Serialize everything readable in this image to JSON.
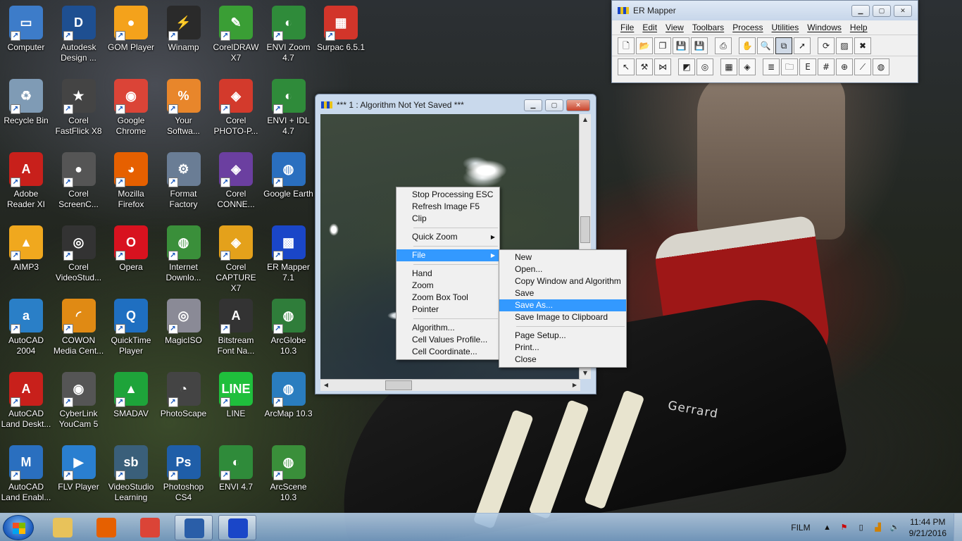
{
  "desktop_icons": [
    {
      "label": "Computer",
      "icon": "computer-icon",
      "color": "#3d7cc9",
      "glyph": "▭",
      "col": 0,
      "row": 0
    },
    {
      "label": "Autodesk Design ...",
      "icon": "autodesk-design-icon",
      "color": "#1e4f91",
      "glyph": "D",
      "col": 1,
      "row": 0
    },
    {
      "label": "GOM Player",
      "icon": "gom-player-icon",
      "color": "#f4a21b",
      "glyph": "●",
      "col": 2,
      "row": 0
    },
    {
      "label": "Winamp",
      "icon": "winamp-icon",
      "color": "#2a2a2a",
      "glyph": "⚡",
      "col": 3,
      "row": 0
    },
    {
      "label": "CorelDRAW X7",
      "icon": "coreldraw-icon",
      "color": "#3a9e35",
      "glyph": "✎",
      "col": 4,
      "row": 0
    },
    {
      "label": "ENVI Zoom 4.7",
      "icon": "envi-zoom-icon",
      "color": "#2f8b3a",
      "glyph": "◐",
      "col": 5,
      "row": 0
    },
    {
      "label": "Surpac 6.5.1",
      "icon": "surpac-icon",
      "color": "#d2352a",
      "glyph": "▦",
      "col": 6,
      "row": 0
    },
    {
      "label": "Recycle Bin",
      "icon": "recycle-bin-icon",
      "color": "#7f9bb5",
      "glyph": "♻",
      "col": 0,
      "row": 1
    },
    {
      "label": "Corel FastFlick X8",
      "icon": "fastflick-icon",
      "color": "#444444",
      "glyph": "★",
      "col": 1,
      "row": 1
    },
    {
      "label": "Google Chrome",
      "icon": "chrome-icon",
      "color": "#db4437",
      "glyph": "◉",
      "col": 2,
      "row": 1
    },
    {
      "label": "Your Softwa...",
      "icon": "your-software-icon",
      "color": "#e8862b",
      "glyph": "%",
      "col": 3,
      "row": 1
    },
    {
      "label": "Corel PHOTO-P...",
      "icon": "corel-photopaint-icon",
      "color": "#d33a2c",
      "glyph": "◈",
      "col": 4,
      "row": 1
    },
    {
      "label": "ENVI + IDL 4.7",
      "icon": "envi-idl-icon",
      "color": "#2f8b3a",
      "glyph": "◐",
      "col": 5,
      "row": 1
    },
    {
      "label": "Adobe Reader XI",
      "icon": "adobe-reader-icon",
      "color": "#c8201b",
      "glyph": "A",
      "col": 0,
      "row": 2
    },
    {
      "label": "Corel ScreenC...",
      "icon": "corel-screencap-icon",
      "color": "#555555",
      "glyph": "●",
      "col": 1,
      "row": 2
    },
    {
      "label": "Mozilla Firefox",
      "icon": "firefox-icon",
      "color": "#e66000",
      "glyph": "◕",
      "col": 2,
      "row": 2
    },
    {
      "label": "Format Factory",
      "icon": "format-factory-icon",
      "color": "#6a7d95",
      "glyph": "⚙",
      "col": 3,
      "row": 2
    },
    {
      "label": "Corel CONNE...",
      "icon": "corel-connect-icon",
      "color": "#6b3fa0",
      "glyph": "◈",
      "col": 4,
      "row": 2
    },
    {
      "label": "Google Earth",
      "icon": "google-earth-icon",
      "color": "#2a6fbf",
      "glyph": "◍",
      "col": 5,
      "row": 2
    },
    {
      "label": "AIMP3",
      "icon": "aimp-icon",
      "color": "#f0a81e",
      "glyph": "▲",
      "col": 0,
      "row": 3
    },
    {
      "label": "Corel VideoStud...",
      "icon": "corel-videostudio-icon",
      "color": "#333333",
      "glyph": "◎",
      "col": 1,
      "row": 3
    },
    {
      "label": "Opera",
      "icon": "opera-icon",
      "color": "#d8121f",
      "glyph": "O",
      "col": 2,
      "row": 3
    },
    {
      "label": "Internet Downlo...",
      "icon": "internet-download-icon",
      "color": "#3a8f3a",
      "glyph": "◍",
      "col": 3,
      "row": 3
    },
    {
      "label": "Corel CAPTURE X7",
      "icon": "corel-capture-icon",
      "color": "#e4a11b",
      "glyph": "◈",
      "col": 4,
      "row": 3
    },
    {
      "label": "ER Mapper 7.1",
      "icon": "er-mapper-icon",
      "color": "#1a46c8",
      "glyph": "▩",
      "col": 5,
      "row": 3
    },
    {
      "label": "AutoCAD 2004",
      "icon": "autocad-2004-icon",
      "color": "#2a7fc7",
      "glyph": "a",
      "col": 0,
      "row": 4
    },
    {
      "label": "COWON Media Cent...",
      "icon": "cowon-icon",
      "color": "#e08a14",
      "glyph": "◜",
      "col": 1,
      "row": 4
    },
    {
      "label": "QuickTime Player",
      "icon": "quicktime-icon",
      "color": "#1f6fc1",
      "glyph": "Q",
      "col": 2,
      "row": 4
    },
    {
      "label": "MagicISO",
      "icon": "magiciso-icon",
      "color": "#8a8a96",
      "glyph": "◎",
      "col": 3,
      "row": 4
    },
    {
      "label": "Bitstream Font Na...",
      "icon": "bitstream-icon",
      "color": "#333333",
      "glyph": "A",
      "col": 4,
      "row": 4
    },
    {
      "label": "ArcGlobe 10.3",
      "icon": "arcglobe-icon",
      "color": "#2f7d3a",
      "glyph": "◍",
      "col": 5,
      "row": 4
    },
    {
      "label": "AutoCAD Land Deskt...",
      "icon": "autocad-land-desktop-icon",
      "color": "#c8201b",
      "glyph": "A",
      "col": 0,
      "row": 5
    },
    {
      "label": "CyberLink YouCam 5",
      "icon": "youcam-icon",
      "color": "#555555",
      "glyph": "◉",
      "col": 1,
      "row": 5
    },
    {
      "label": "SMADAV",
      "icon": "smadav-icon",
      "color": "#1ea43a",
      "glyph": "▲",
      "col": 2,
      "row": 5
    },
    {
      "label": "PhotoScape",
      "icon": "photoscape-icon",
      "color": "#444444",
      "glyph": "◔",
      "col": 3,
      "row": 5
    },
    {
      "label": "LINE",
      "icon": "line-icon",
      "color": "#1fbf3c",
      "glyph": "LINE",
      "col": 4,
      "row": 5
    },
    {
      "label": "ArcMap 10.3",
      "icon": "arcmap-icon",
      "color": "#2a7dbf",
      "glyph": "◍",
      "col": 5,
      "row": 5
    },
    {
      "label": "AutoCAD Land Enabl...",
      "icon": "autocad-land-enabled-icon",
      "color": "#2a6fbf",
      "glyph": "M",
      "col": 0,
      "row": 6
    },
    {
      "label": "FLV Player",
      "icon": "flv-player-icon",
      "color": "#2a7fd0",
      "glyph": "▶",
      "col": 1,
      "row": 6
    },
    {
      "label": "VideoStudio Learning",
      "icon": "videostudio-learning-icon",
      "color": "#3a5f7a",
      "glyph": "sb",
      "col": 2,
      "row": 6
    },
    {
      "label": "Photoshop CS4",
      "icon": "photoshop-icon",
      "color": "#1f5ea8",
      "glyph": "Ps",
      "col": 3,
      "row": 6
    },
    {
      "label": "ENVI 4.7",
      "icon": "envi-icon",
      "color": "#2f8b3a",
      "glyph": "◐",
      "col": 4,
      "row": 6
    },
    {
      "label": "ArcScene 10.3",
      "icon": "arcscene-icon",
      "color": "#3a8f3a",
      "glyph": "◍",
      "col": 5,
      "row": 6
    }
  ],
  "er_mapper": {
    "title": "ER Mapper",
    "menu": [
      "File",
      "Edit",
      "View",
      "Toolbars",
      "Process",
      "Utilities",
      "Windows",
      "Help"
    ],
    "toolbar1": [
      {
        "icon": "new-icon",
        "glyph": "🗋"
      },
      {
        "icon": "open-icon",
        "glyph": "📂"
      },
      {
        "icon": "copy-window-icon",
        "glyph": "❐"
      },
      {
        "icon": "save-icon",
        "glyph": "💾"
      },
      {
        "icon": "save-as-icon",
        "glyph": "💾"
      },
      {
        "icon": "print-icon",
        "glyph": "⎙"
      },
      {
        "icon": "hand-icon",
        "glyph": "✋"
      },
      {
        "icon": "zoom-icon",
        "glyph": "🔍"
      },
      {
        "icon": "zoom-box-icon",
        "glyph": "⧉"
      },
      {
        "icon": "pointer-icon",
        "glyph": "➚"
      },
      {
        "icon": "refresh-icon",
        "glyph": "⟳"
      },
      {
        "icon": "stretch-icon",
        "glyph": "▨"
      },
      {
        "icon": "stop-icon",
        "glyph": "✖"
      }
    ],
    "toolbar2": [
      {
        "icon": "tool-a-icon",
        "glyph": "↖"
      },
      {
        "icon": "tool-b-icon",
        "glyph": "⚒"
      },
      {
        "icon": "tool-c-icon",
        "glyph": "⋈"
      },
      {
        "icon": "tool-d-icon",
        "glyph": "◩"
      },
      {
        "icon": "tool-e-icon",
        "glyph": "◎"
      },
      {
        "icon": "tool-f-icon",
        "glyph": "▦"
      },
      {
        "icon": "tool-g-icon",
        "glyph": "◈"
      },
      {
        "icon": "layers-icon",
        "glyph": "≣"
      },
      {
        "icon": "folder-layers-icon",
        "glyph": "🗀"
      },
      {
        "icon": "formula-icon",
        "glyph": "E"
      },
      {
        "icon": "grid-icon",
        "glyph": "#"
      },
      {
        "icon": "target-icon",
        "glyph": "⊕"
      },
      {
        "icon": "graph-icon",
        "glyph": "⟋"
      },
      {
        "icon": "globe-icon",
        "glyph": "◍"
      }
    ]
  },
  "algorithm_window": {
    "title": "*** 1 : Algorithm Not Yet Saved ***"
  },
  "context_menu": {
    "items": [
      {
        "label": "Stop Processing ESC",
        "type": "item"
      },
      {
        "label": "Refresh Image F5",
        "type": "item"
      },
      {
        "label": "Clip",
        "type": "item"
      },
      {
        "type": "sep"
      },
      {
        "label": "Quick Zoom",
        "type": "submenu"
      },
      {
        "type": "sep"
      },
      {
        "label": "File",
        "type": "submenu",
        "highlighted": true
      },
      {
        "type": "sep"
      },
      {
        "label": "Hand",
        "type": "item"
      },
      {
        "label": "Zoom",
        "type": "item"
      },
      {
        "label": "Zoom Box Tool",
        "type": "item"
      },
      {
        "label": "Pointer",
        "type": "item"
      },
      {
        "type": "sep"
      },
      {
        "label": "Algorithm...",
        "type": "item"
      },
      {
        "label": "Cell Values Profile...",
        "type": "item"
      },
      {
        "label": "Cell Coordinate...",
        "type": "item"
      }
    ]
  },
  "file_submenu": {
    "items": [
      {
        "label": "New",
        "type": "item"
      },
      {
        "label": "Open...",
        "type": "item"
      },
      {
        "label": "Copy Window and Algorithm",
        "type": "item"
      },
      {
        "label": "Save",
        "type": "item"
      },
      {
        "label": "Save As...",
        "type": "item",
        "highlighted": true
      },
      {
        "label": "Save Image to Clipboard",
        "type": "item"
      },
      {
        "type": "sep"
      },
      {
        "label": "Page Setup...",
        "type": "item"
      },
      {
        "label": "Print...",
        "type": "item"
      },
      {
        "label": "Close",
        "type": "item"
      }
    ]
  },
  "taskbar": {
    "pinned": [
      {
        "icon": "explorer-icon",
        "color": "#e8c25a",
        "active": false
      },
      {
        "icon": "firefox-taskbar-icon",
        "color": "#e66000",
        "active": false
      },
      {
        "icon": "chrome-taskbar-icon",
        "color": "#db4437",
        "active": false
      },
      {
        "icon": "word-icon",
        "color": "#2a5ea8",
        "active": true
      },
      {
        "icon": "er-mapper-taskbar-icon",
        "color": "#1a46c8",
        "active": true
      }
    ],
    "tray_label": "FILM",
    "time": "11:44 PM",
    "date": "9/21/2016"
  },
  "wallpaper_text": "Gerrard"
}
